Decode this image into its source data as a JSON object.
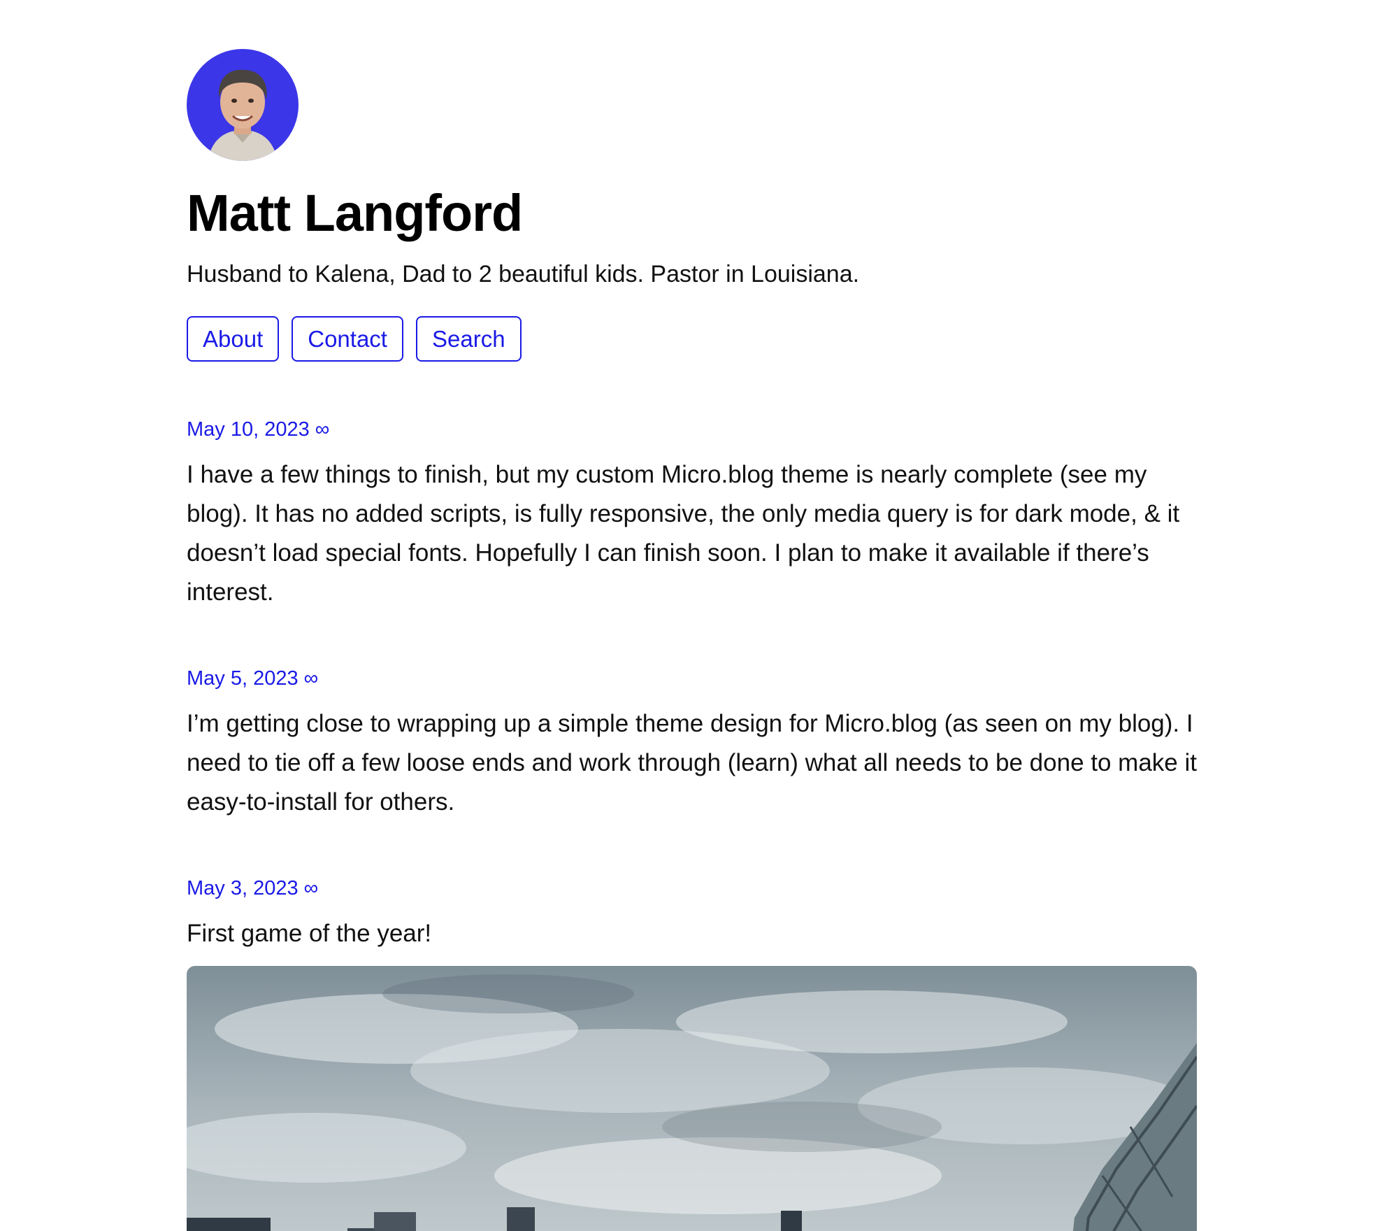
{
  "header": {
    "avatar_icon": "avatar-photo",
    "title": "Matt Langford",
    "tagline": "Husband to Kalena, Dad to 2 beautiful kids. Pastor in Louisiana."
  },
  "nav": {
    "about": "About",
    "contact": "Contact",
    "search": "Search"
  },
  "posts": [
    {
      "date": "May 10, 2023 ∞",
      "body": "I have a few things to finish, but my custom Micro.blog theme is nearly complete (see my blog). It has no added scripts, is fully responsive, the only media query is for dark mode, & it doesn’t load special fonts. Hopefully I can finish soon. I plan to make it available if there’s interest."
    },
    {
      "date": "May 5, 2023 ∞",
      "body": "I’m getting close to wrapping up a simple theme design for Micro.blog (as seen on my blog). I need to tie off a few loose ends and work through (learn) what all needs to be done to make it easy-to-install for others."
    },
    {
      "date": "May 3, 2023 ∞",
      "body": "First game of the year!"
    }
  ],
  "colors": {
    "accent": "#1a1ae6",
    "avatar_background": "#3b3be6",
    "text": "#111111"
  }
}
